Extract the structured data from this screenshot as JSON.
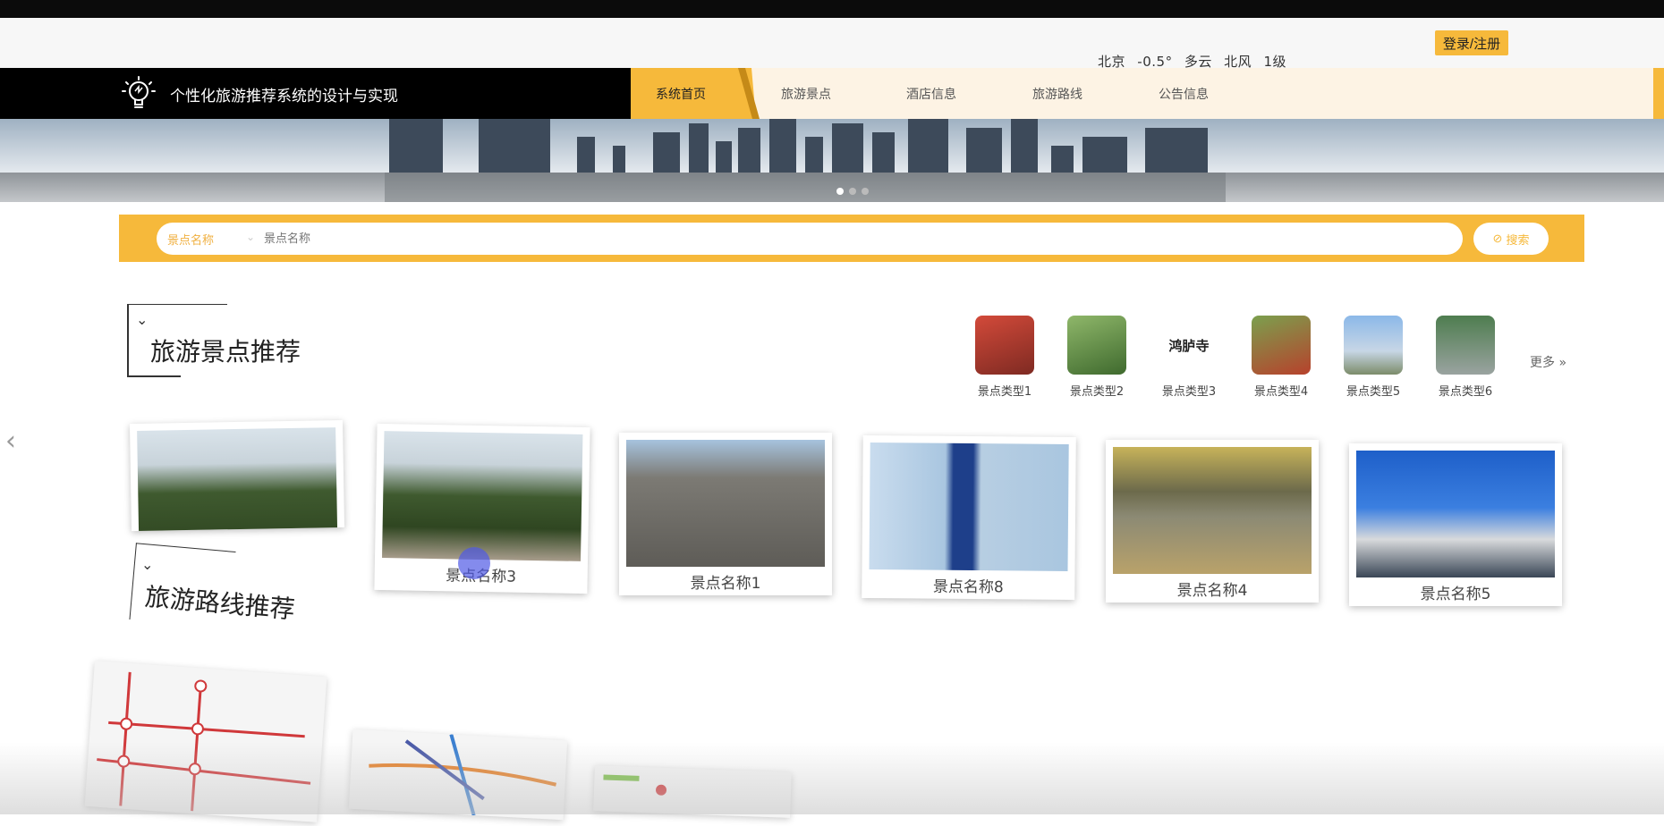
{
  "weather": {
    "city": "北京",
    "temp": "-0.5°",
    "condition": "多云",
    "wind": "北风",
    "level": "1级"
  },
  "auth": {
    "login_label": "登录/注册"
  },
  "site": {
    "title": "个性化旅游推荐系统的设计与实现"
  },
  "nav": {
    "items": [
      {
        "label": "系统首页",
        "active": true
      },
      {
        "label": "旅游景点",
        "active": false
      },
      {
        "label": "酒店信息",
        "active": false
      },
      {
        "label": "旅游路线",
        "active": false
      },
      {
        "label": "公告信息",
        "active": false
      }
    ]
  },
  "search": {
    "select_label": "景点名称",
    "placeholder": "景点名称",
    "button_label": "搜索"
  },
  "attractions": {
    "title": "旅游景点推荐",
    "more_label": "更多 »",
    "types": [
      {
        "label": "景点类型1",
        "color": "#b5392c"
      },
      {
        "label": "景点类型2",
        "color": "#4f8a3c"
      },
      {
        "label": "景点类型3",
        "text": "鸿胪寺",
        "color": "#ffffff"
      },
      {
        "label": "景点类型4",
        "color": "#5a8c3a"
      },
      {
        "label": "景点类型5",
        "color": "#7aa7d8"
      },
      {
        "label": "景点类型6",
        "color": "#3f6b44"
      }
    ],
    "cards": [
      {
        "label": ""
      },
      {
        "label": "景点名称3"
      },
      {
        "label": "景点名称1"
      },
      {
        "label": "景点名称8"
      },
      {
        "label": "景点名称4"
      },
      {
        "label": "景点名称5"
      }
    ]
  },
  "routes": {
    "title": "旅游路线推荐"
  },
  "colors": {
    "accent": "#f6b93b",
    "nav_bg": "#000000",
    "menu_bg": "#fdf3e4"
  }
}
